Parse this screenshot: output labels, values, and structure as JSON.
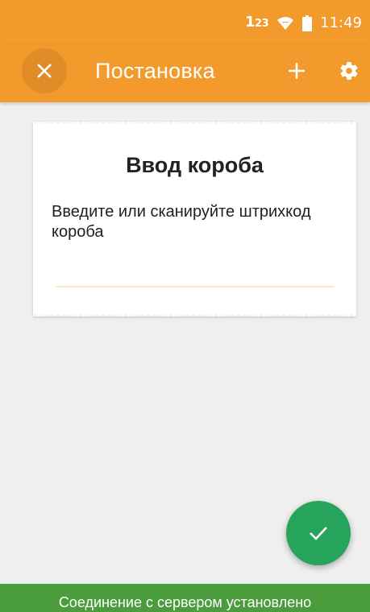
{
  "status_bar": {
    "indicator_main": "1",
    "indicator_small": "23",
    "time": "11:49",
    "icons": [
      "wifi-icon",
      "battery-icon"
    ]
  },
  "app_bar": {
    "title": "Постановка",
    "left_icon": "close-icon",
    "right_icons": [
      "add-icon",
      "settings-icon"
    ]
  },
  "card": {
    "title": "Ввод короба",
    "instruction": "Введите или сканируйте штрихкод короба",
    "barcode_value": "",
    "barcode_placeholder": ""
  },
  "fab": {
    "icon": "check-icon"
  },
  "connection": {
    "status_text": "Соединение с сервером установлено"
  },
  "colors": {
    "primary": "#f39a2c",
    "background": "#efefef",
    "fab": "#27a45b",
    "connection_bar": "#4a9c3c"
  }
}
